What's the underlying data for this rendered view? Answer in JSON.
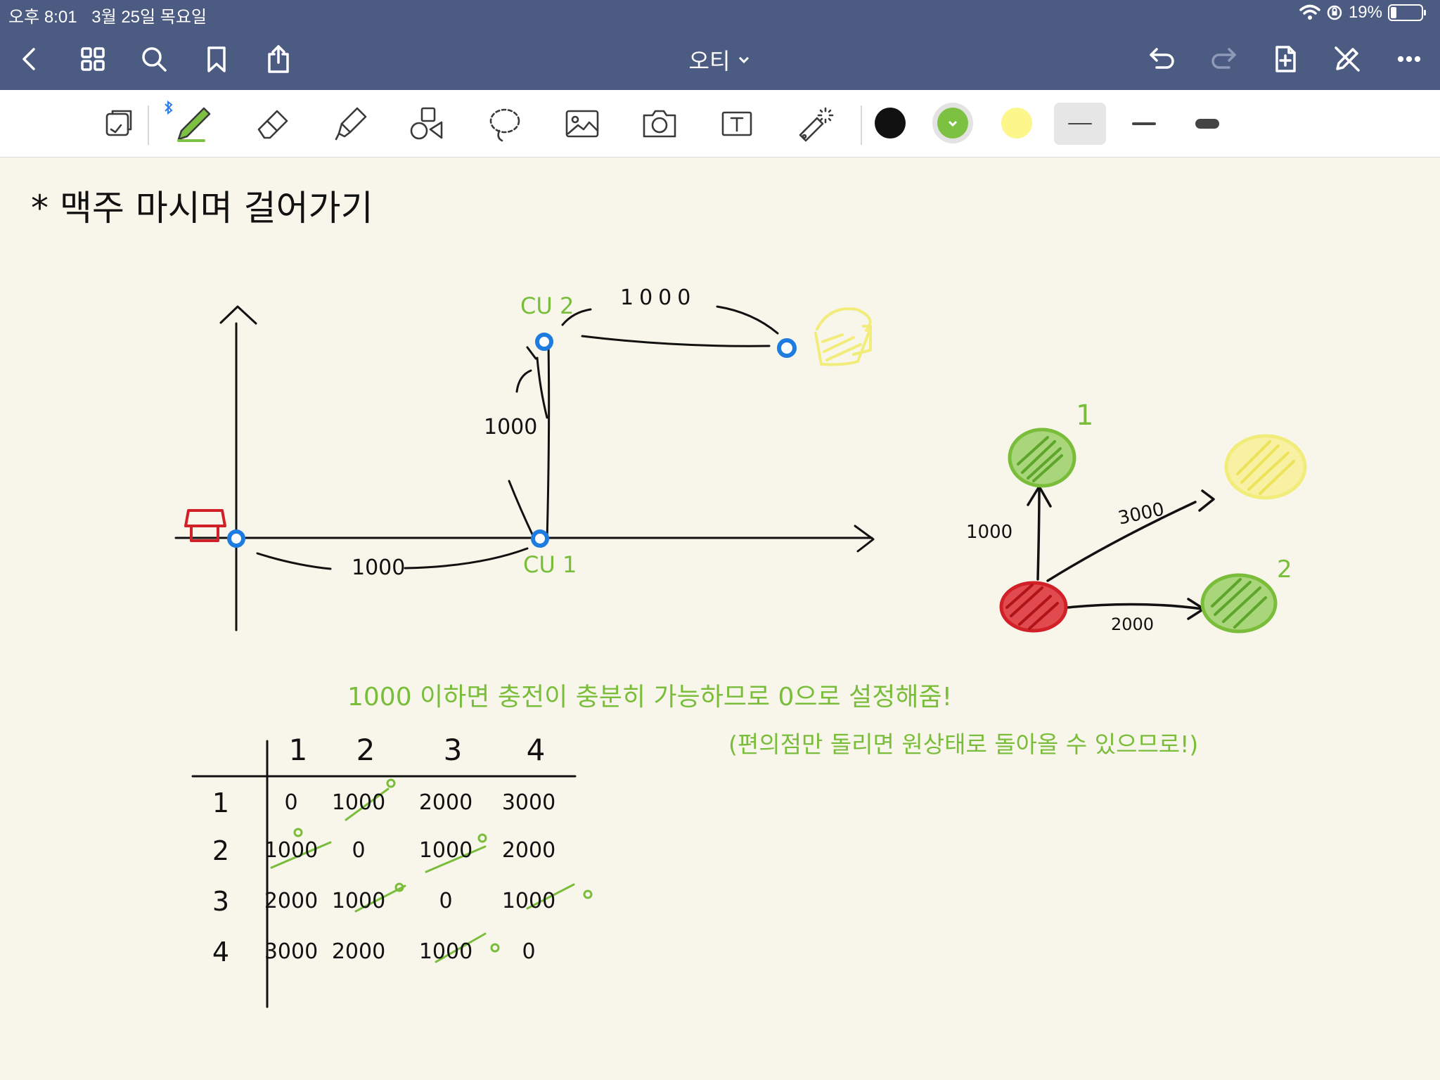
{
  "status_bar": {
    "time": "오후 8:01",
    "date": "3월 25일 목요일",
    "battery": "19%",
    "battery_level": 0.19
  },
  "nav": {
    "title": "오티",
    "icons": {
      "back": "chevron-left-icon",
      "thumbnails": "grid-icon",
      "search": "search-icon",
      "bookmark": "bookmark-icon",
      "share": "share-icon",
      "undo": "undo-icon",
      "redo": "redo-icon",
      "add_page": "add-page-icon",
      "close_tools": "pencil-off-icon",
      "more": "more-icon"
    }
  },
  "toolbar": {
    "tools": [
      "lasso-select-icon",
      "pen-icon",
      "eraser-icon",
      "highlighter-icon",
      "shapes-icon",
      "lasso-icon",
      "image-icon",
      "camera-icon",
      "text-icon",
      "laser-pointer-icon"
    ],
    "selected_tool": "pen",
    "colors": [
      "#111111",
      "#7dc142",
      "#fdf68a"
    ],
    "selected_color": "#7dc142",
    "stroke_widths": [
      "thin",
      "medium",
      "thick"
    ],
    "selected_stroke": "thin"
  },
  "note": {
    "heading": "* 맥주 마시며 걸어가기",
    "edge_labels": {
      "store_to_cu1": "1000",
      "cu1_to_cu2": "1000",
      "cu2_to_beer": "1000"
    },
    "node_labels": {
      "cu1": "CU 1",
      "cu2": "CU 2"
    },
    "graph": {
      "node_label_1": "1",
      "node_label_2": "2",
      "edge_up": "1000",
      "edge_diag": "3000",
      "edge_right": "2000"
    },
    "remark_1": "1000 이하면 충전이 충분히 가능하므로 0으로 설정해줌!",
    "remark_2": "(편의점만 돌리면 원상태로 돌아올 수 있으므로!)",
    "matrix": {
      "col_headers": [
        "1",
        "2",
        "3",
        "4"
      ],
      "row_headers": [
        "1",
        "2",
        "3",
        "4"
      ],
      "rows": [
        [
          "0",
          "1000",
          "2000",
          "3000"
        ],
        [
          "1000",
          "0",
          "1000",
          "2000"
        ],
        [
          "2000",
          "1000",
          "0",
          "1000"
        ],
        [
          "3000",
          "2000",
          "1000",
          "0"
        ]
      ],
      "override_value": "0"
    }
  }
}
